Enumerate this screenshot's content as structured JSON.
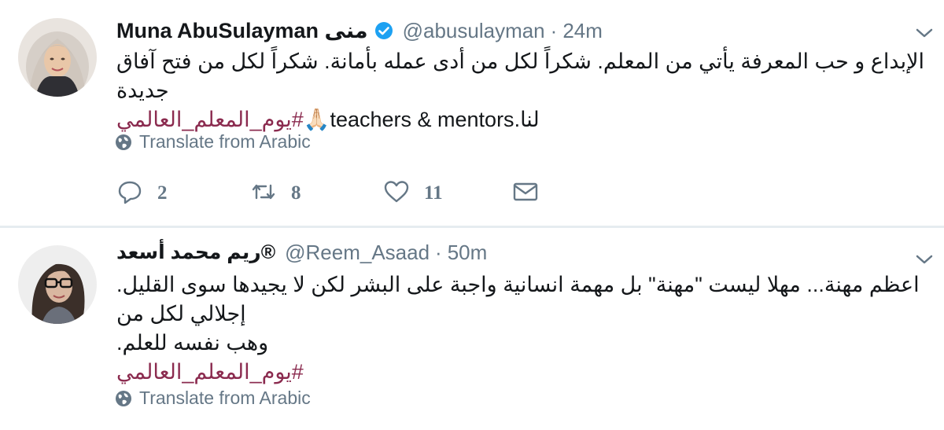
{
  "tweets": [
    {
      "display_name": "Muna AbuSulayman منى",
      "verified": true,
      "handle": "@abusulayman",
      "separator": "·",
      "time": "24m",
      "text_lines": [
        "الإبداع و حب المعرفة يأتي من المعلم. شكراً لكل من أدى عمله بأمانة. شكراً لكل من فتح آفاق جديدة",
        "لنا.teachers & mentors"
      ],
      "emoji": "🙏🏻",
      "hashtag": "#يوم_المعلم_العالمي",
      "translate_label": "Translate from Arabic",
      "reply_count": "2",
      "retweet_count": "8",
      "like_count": "11"
    },
    {
      "display_name": "ريم محمد أسعد®",
      "verified": false,
      "handle": "@Reem_Asaad",
      "separator": "·",
      "time": "50m",
      "text_lines": [
        "اعظم مهنة... مهلا ليست \"مهنة\" بل مهمة انسانية واجبة على البشر لكن لا يجيدها سوى القليل. إجلالي لكل من",
        "وهب نفسه للعلم."
      ],
      "hashtag": "#يوم_المعلم_العالمي",
      "translate_label": "Translate from Arabic"
    }
  ],
  "icons": {
    "verified": "verified-badge-icon",
    "caret": "chevron-down-icon",
    "globe": "globe-icon",
    "reply": "reply-icon",
    "retweet": "retweet-icon",
    "like": "heart-icon",
    "dm": "envelope-icon"
  },
  "colors": {
    "hashtag": "#8b2b4f",
    "secondary_text": "#657786",
    "verified": "#1da1f2",
    "divider": "#e6ecf0"
  }
}
